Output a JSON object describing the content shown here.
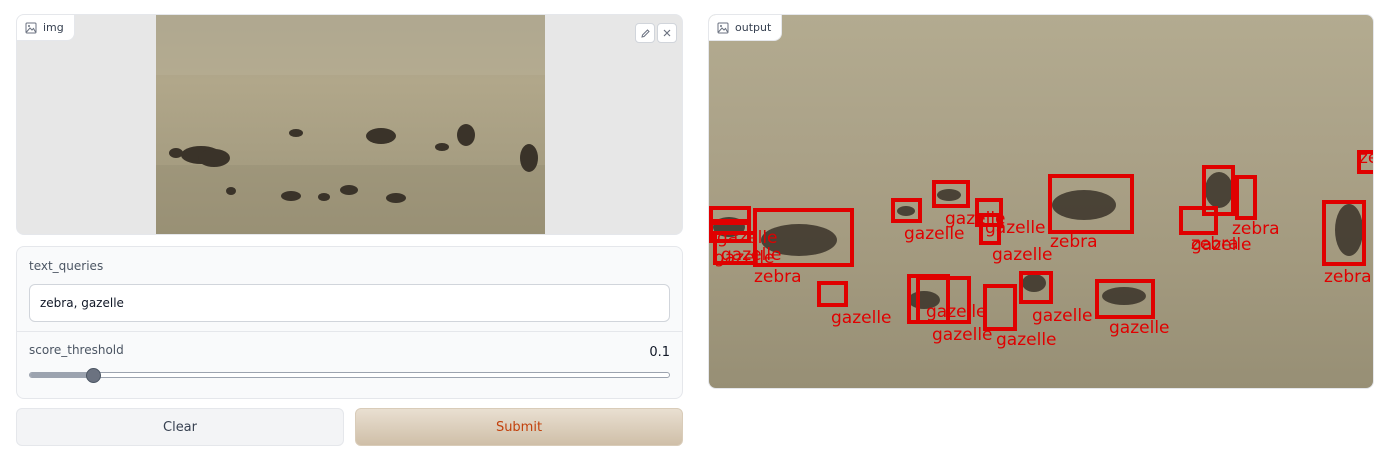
{
  "input_image": {
    "label": "img",
    "edit_icon": "pencil-icon",
    "close_icon": "close-icon"
  },
  "text_queries": {
    "label": "text_queries",
    "value": "zebra, gazelle"
  },
  "score_threshold": {
    "label": "score_threshold",
    "value": "0.1",
    "fraction": 0.1
  },
  "buttons": {
    "clear": "Clear",
    "submit": "Submit"
  },
  "output_image": {
    "label": "output",
    "detection_color": "#e00000",
    "detections": [
      {
        "label": "zebra"
      },
      {
        "label": "zebra"
      },
      {
        "label": "zebra"
      },
      {
        "label": "zebra"
      },
      {
        "label": "zebra"
      },
      {
        "label": "zebra"
      },
      {
        "label": "gazelle"
      },
      {
        "label": "gazelle"
      },
      {
        "label": "gazelle"
      },
      {
        "label": "gazelle"
      },
      {
        "label": "gazelle"
      },
      {
        "label": "gazelle"
      },
      {
        "label": "gazelle"
      },
      {
        "label": "gazelle"
      },
      {
        "label": "gazelle"
      },
      {
        "label": "gazelle"
      },
      {
        "label": "gazelle"
      },
      {
        "label": "gazelle"
      },
      {
        "label": "gazelle"
      },
      {
        "label": "gazelle"
      }
    ]
  }
}
